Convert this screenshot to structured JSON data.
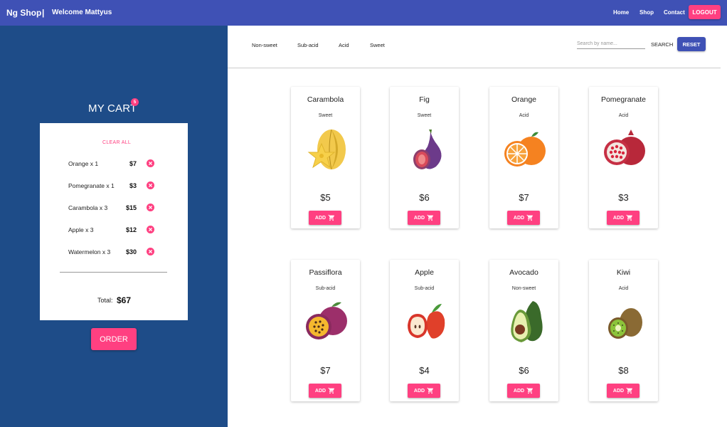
{
  "header": {
    "brand": "Ng Shop",
    "separator": "|",
    "welcome": "Welcome Mattyus",
    "nav": [
      "Home",
      "Shop",
      "Contact"
    ],
    "logout_label": "LOGOUT"
  },
  "cart": {
    "title": "MY CART",
    "badge_count": "5",
    "clear_all": "CLEAR ALL",
    "items": [
      {
        "label": "Orange x 1",
        "price": "$7"
      },
      {
        "label": "Pomegranate x 1",
        "price": "$3"
      },
      {
        "label": "Carambola x 3",
        "price": "$15"
      },
      {
        "label": "Apple x 3",
        "price": "$12"
      },
      {
        "label": "Watermelon x 3",
        "price": "$30"
      }
    ],
    "total_label": "Total:",
    "total_value": "$67",
    "order_label": "ORDER"
  },
  "filters": [
    "Non-sweet",
    "Sub-acid",
    "Acid",
    "Sweet"
  ],
  "search": {
    "placeholder": "Search by name...",
    "search_label": "SEARCH",
    "reset_label": "RESET"
  },
  "products": [
    {
      "name": "Carambola",
      "type": "Sweet",
      "price": "$5",
      "icon": "carambola-icon"
    },
    {
      "name": "Fig",
      "type": "Sweet",
      "price": "$6",
      "icon": "fig-icon"
    },
    {
      "name": "Orange",
      "type": "Acid",
      "price": "$7",
      "icon": "orange-icon"
    },
    {
      "name": "Pomegranate",
      "type": "Acid",
      "price": "$3",
      "icon": "pomegranate-icon"
    },
    {
      "name": "Passiflora",
      "type": "Sub-acid",
      "price": "$7",
      "icon": "passiflora-icon"
    },
    {
      "name": "Apple",
      "type": "Sub-acid",
      "price": "$4",
      "icon": "apple-icon"
    },
    {
      "name": "Avocado",
      "type": "Non-sweet",
      "price": "$6",
      "icon": "avocado-icon"
    },
    {
      "name": "Kiwi",
      "type": "Acid",
      "price": "$8",
      "icon": "kiwi-icon"
    }
  ],
  "add_label": "ADD",
  "colors": {
    "primary": "#3f51b5",
    "accent": "#ff4081",
    "sidebar": "#1e4c88"
  }
}
